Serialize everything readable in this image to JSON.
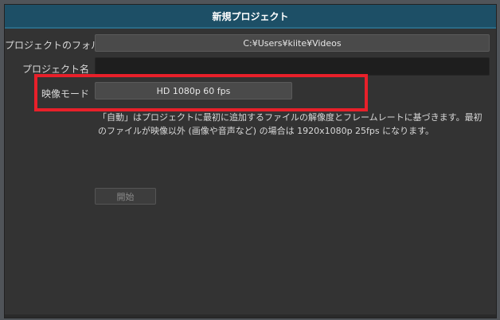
{
  "dialog": {
    "title": "新規プロジェクト"
  },
  "form": {
    "folder_label": "プロジェクトのフォルダ",
    "folder_value": "C:¥Users¥kiite¥Videos",
    "name_label": "プロジェクト名",
    "name_value": "",
    "video_mode_label": "映像モード",
    "video_mode_value": "HD 1080p 60 fps",
    "description": "「自動」はプロジェクトに最初に追加するファイルの解像度とフレームレートに基づきます。最初のファイルが映像以外 (画像や音声など) の場合は 1920x1080p 25fps になります。",
    "start_label": "開始"
  },
  "colors": {
    "titlebar": "#1d4f66",
    "highlight": "#e8202a",
    "background": "#333333"
  }
}
